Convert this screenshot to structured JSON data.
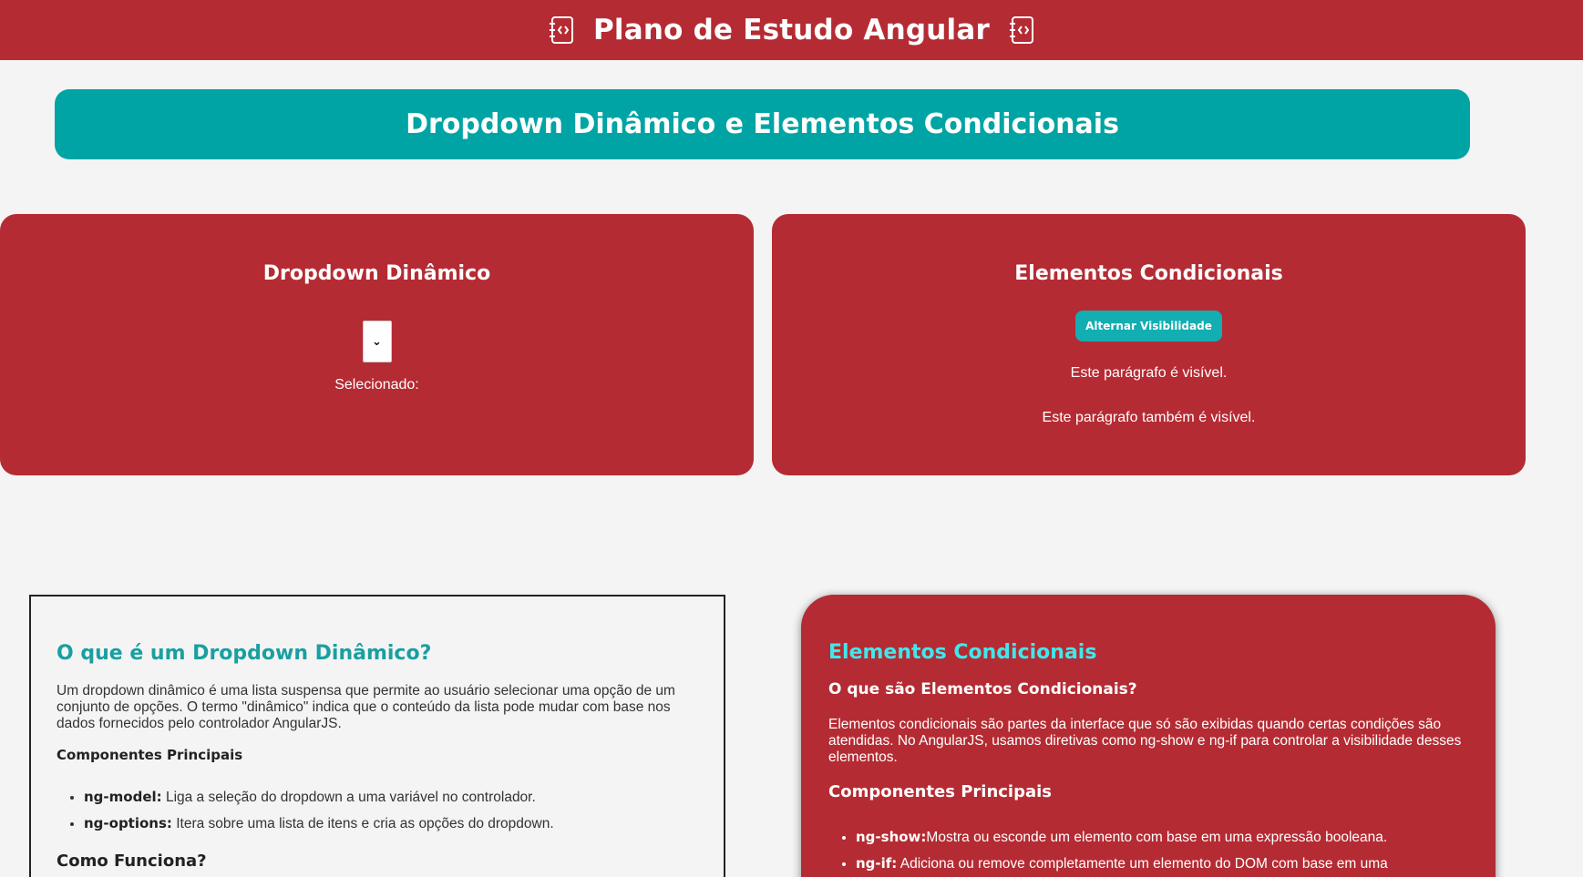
{
  "header": {
    "title": "Plano de Estudo Angular",
    "left_icon": "code-notebook-icon",
    "right_icon": "code-notebook-icon",
    "background": "#b52b33"
  },
  "banner": {
    "title": "Dropdown Dinâmico e Elementos Condicionais",
    "background": "#00a4a4"
  },
  "dropdown_card": {
    "title": "Dropdown Dinâmico",
    "select_value": "",
    "selected_label": "Selecionado:"
  },
  "conditional_card": {
    "title": "Elementos Condicionais",
    "toggle_button": "Alternar Visibilidade",
    "paragraph_1": "Este parágrafo é visível.",
    "paragraph_2": "Este parágrafo também é visível."
  },
  "dropdown_explanation": {
    "title": "O que é um Dropdown Dinâmico?",
    "description": "Um dropdown dinâmico é uma lista suspensa que permite ao usuário selecionar uma opção de um conjunto de opções. O termo \"dinâmico\" indica que o conteúdo da lista pode mudar com base nos dados fornecidos pelo controlador AngularJS.",
    "components_heading": "Componentes Principais",
    "components": [
      {
        "term": "ng-model:",
        "text": " Liga a seleção do dropdown a uma variável no controlador."
      },
      {
        "term": "ng-options:",
        "text": " Itera sobre uma lista de itens e cria as opções do dropdown."
      }
    ],
    "how_heading": "Como Funciona?"
  },
  "conditional_explanation": {
    "title": "Elementos Condicionais",
    "question": "O que são Elementos Condicionais?",
    "description": "Elementos condicionais são partes da interface que só são exibidas quando certas condições são atendidas. No AngularJS, usamos diretivas como ng-show e ng-if para controlar a visibilidade desses elementos.",
    "components_heading": "Componentes Principais",
    "components": [
      {
        "term": "ng-show:",
        "text": "Mostra ou esconde um elemento com base em uma expressão booleana."
      },
      {
        "term": "ng-if:",
        "text": " Adiciona ou remove completamente um elemento do DOM com base em uma"
      }
    ]
  }
}
